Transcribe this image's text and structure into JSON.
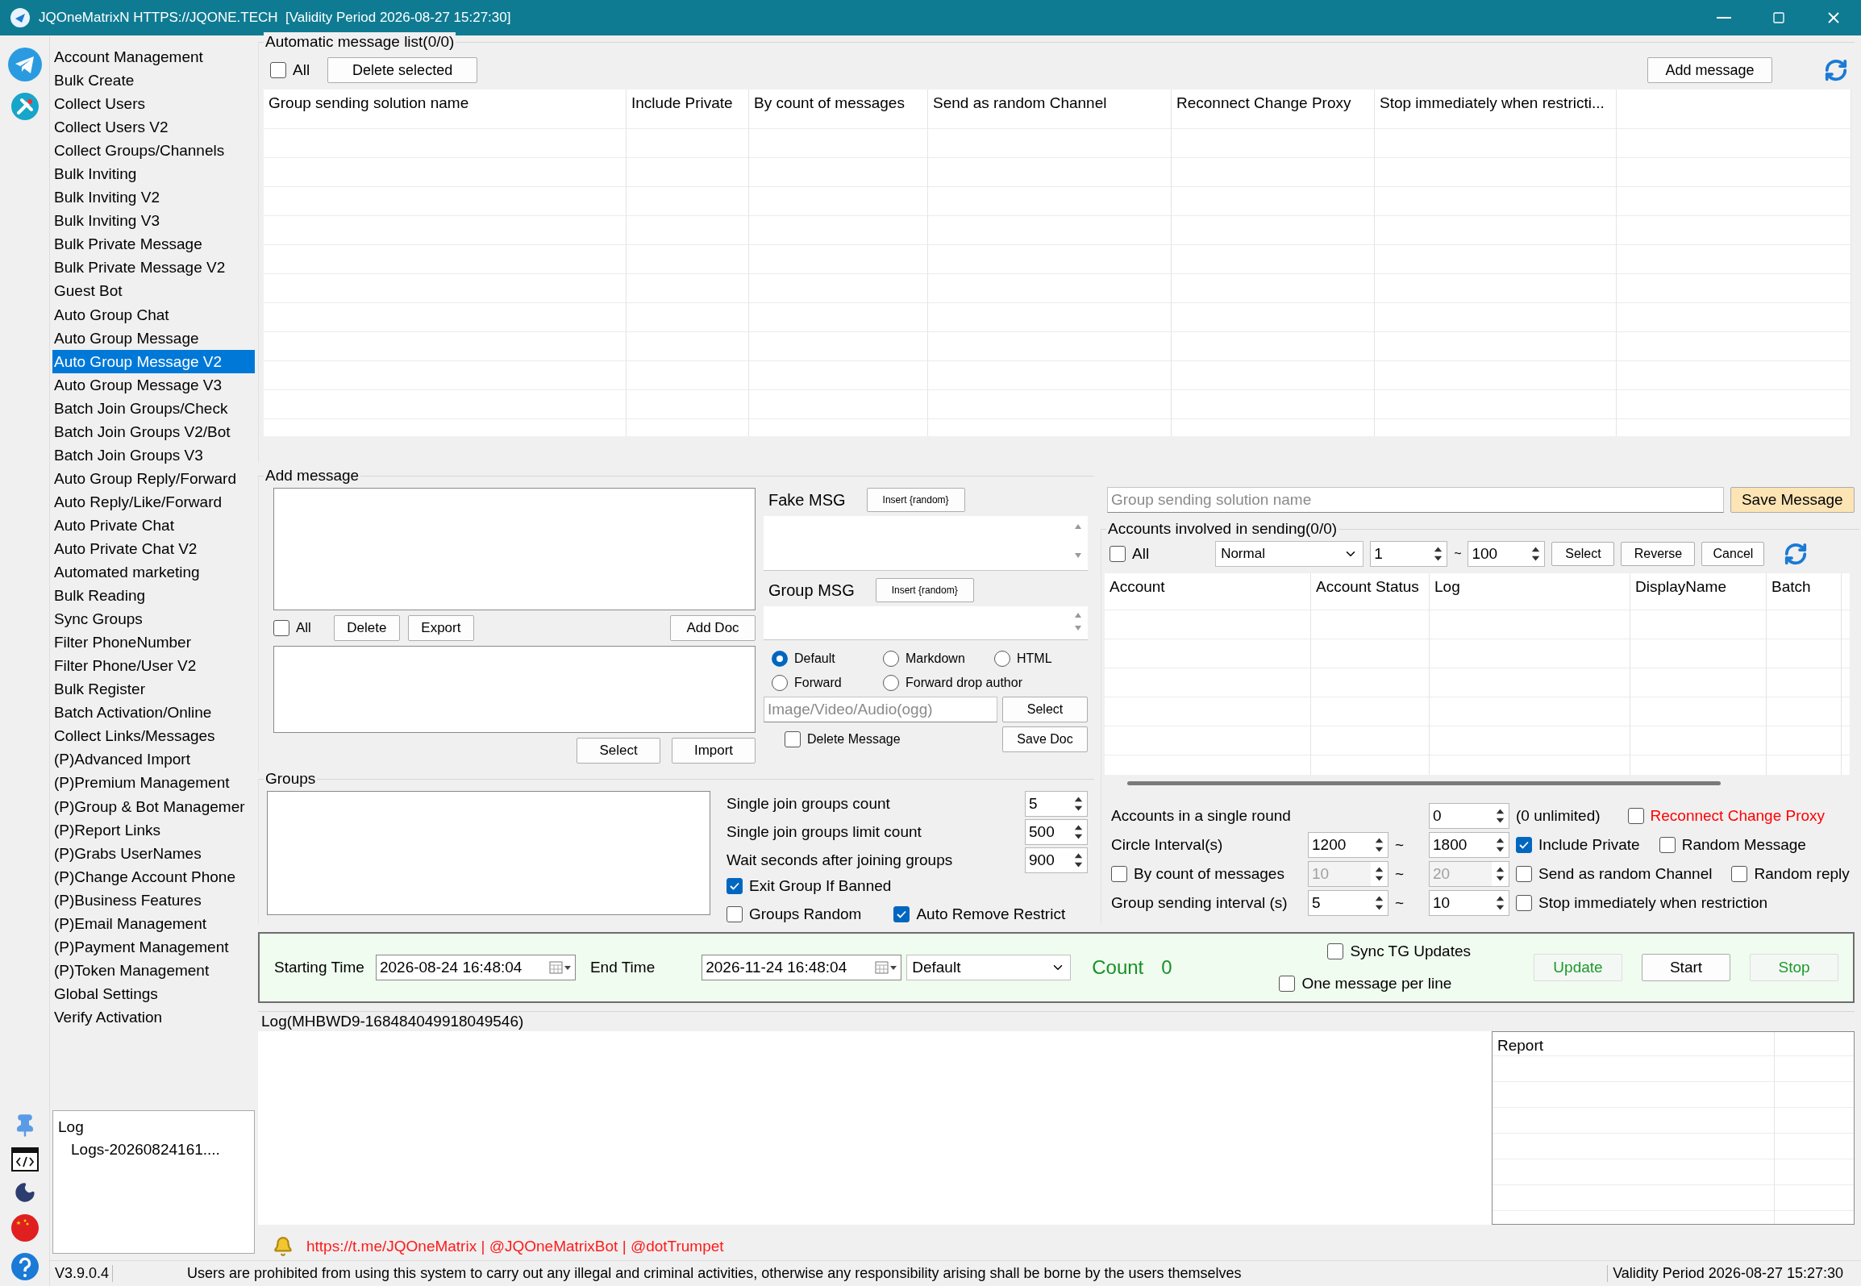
{
  "window": {
    "title": "JQOneMatrixN HTTPS://JQONE.TECH  [Validity Period 2026-08-27 15:27:30]"
  },
  "sidebar": {
    "items": [
      {
        "label": "Account Management",
        "selected": false
      },
      {
        "label": "Bulk Create",
        "selected": false
      },
      {
        "label": "Collect Users",
        "selected": false
      },
      {
        "label": "Collect Users V2",
        "selected": false
      },
      {
        "label": "Collect Groups/Channels",
        "selected": false
      },
      {
        "label": "Bulk Inviting",
        "selected": false
      },
      {
        "label": "Bulk Inviting V2",
        "selected": false
      },
      {
        "label": "Bulk Inviting V3",
        "selected": false
      },
      {
        "label": "Bulk Private Message",
        "selected": false
      },
      {
        "label": "Bulk Private Message V2",
        "selected": false
      },
      {
        "label": "Guest Bot",
        "selected": false
      },
      {
        "label": "Auto Group Chat",
        "selected": false
      },
      {
        "label": "Auto Group Message",
        "selected": false
      },
      {
        "label": "Auto Group Message V2",
        "selected": true
      },
      {
        "label": "Auto Group Message V3",
        "selected": false
      },
      {
        "label": "Batch Join Groups/Check",
        "selected": false
      },
      {
        "label": "Batch Join Groups V2/Bot",
        "selected": false
      },
      {
        "label": "Batch Join Groups V3",
        "selected": false
      },
      {
        "label": "Auto Group Reply/Forward",
        "selected": false
      },
      {
        "label": "Auto Reply/Like/Forward",
        "selected": false
      },
      {
        "label": "Auto Private Chat",
        "selected": false
      },
      {
        "label": "Auto Private Chat V2",
        "selected": false
      },
      {
        "label": "Automated marketing",
        "selected": false
      },
      {
        "label": "Bulk Reading",
        "selected": false
      },
      {
        "label": "Sync Groups",
        "selected": false
      },
      {
        "label": "Filter PhoneNumber",
        "selected": false
      },
      {
        "label": "Filter Phone/User V2",
        "selected": false
      },
      {
        "label": "Bulk Register",
        "selected": false
      },
      {
        "label": "Batch Activation/Online",
        "selected": false
      },
      {
        "label": "Collect Links/Messages",
        "selected": false
      },
      {
        "label": "(P)Advanced Import",
        "selected": false
      },
      {
        "label": "(P)Premium Management",
        "selected": false
      },
      {
        "label": "(P)Group & Bot Managemer",
        "selected": false
      },
      {
        "label": "(P)Report Links",
        "selected": false
      },
      {
        "label": "(P)Grabs UserNames",
        "selected": false
      },
      {
        "label": "(P)Change Account Phone",
        "selected": false
      },
      {
        "label": "(P)Business Features",
        "selected": false
      },
      {
        "label": "(P)Email Management",
        "selected": false
      },
      {
        "label": "(P)Payment Management",
        "selected": false
      },
      {
        "label": "(P)Token Management",
        "selected": false
      },
      {
        "label": "Global Settings",
        "selected": false
      },
      {
        "label": "Verify Activation",
        "selected": false
      }
    ],
    "log_panel": {
      "title": "Log",
      "entries": [
        "Logs-20260824161...."
      ]
    },
    "version": "V3.9.0.4"
  },
  "message_list": {
    "title": "Automatic message list(0/0)",
    "all": {
      "label": "All",
      "checked": false
    },
    "delete_button": "Delete selected",
    "add_button": "Add message",
    "columns": [
      "Group sending solution name",
      "Include Private",
      "By count of messages",
      "Send as random Channel",
      "Reconnect Change Proxy",
      "Stop immediately when restricti..."
    ]
  },
  "add_message": {
    "title": "Add message",
    "all": {
      "label": "All",
      "checked": false
    },
    "list_buttons": [
      "Delete",
      "Export"
    ],
    "add_doc_button": "Add Doc",
    "file_buttons": [
      "Select",
      "Import"
    ],
    "fake_msg": {
      "label": "Fake MSG",
      "insert_button": "Insert {random}"
    },
    "group_msg": {
      "label": "Group MSG",
      "insert_button": "Insert {random}"
    },
    "formats": [
      {
        "label": "Default",
        "selected": true
      },
      {
        "label": "Markdown",
        "selected": false
      },
      {
        "label": "HTML",
        "selected": false
      },
      {
        "label": "Forward",
        "selected": false
      },
      {
        "label": "Forward drop author",
        "selected": false
      }
    ],
    "media": {
      "placeholder": "Image/Video/Audio(ogg)",
      "select_button": "Select"
    },
    "delete_message": {
      "label": "Delete Message",
      "checked": false
    },
    "save_doc_button": "Save Doc"
  },
  "groups": {
    "title": "Groups",
    "counts": [
      {
        "label": "Single join groups count",
        "value": "5",
        "disabled": false
      },
      {
        "label": "Single join groups limit count",
        "value": "500",
        "disabled": false
      },
      {
        "label": "Wait seconds after joining groups",
        "value": "900",
        "disabled": false
      }
    ],
    "options": [
      {
        "label": "Exit Group If Banned",
        "checked": true
      },
      {
        "label": "Groups Random",
        "checked": false
      },
      {
        "label": "Auto Remove Restrict",
        "checked": true
      }
    ]
  },
  "solution": {
    "placeholder": "Group sending solution name",
    "save_button": "Save Message"
  },
  "accounts": {
    "title": "Accounts involved in sending(0/0)",
    "all": {
      "label": "All",
      "checked": false
    },
    "filter": "Normal",
    "from": {
      "value": "1",
      "disabled": false
    },
    "separator": "~",
    "to": {
      "value": "100",
      "disabled": false
    },
    "buttons": [
      "Select",
      "Reverse",
      "Cancel"
    ],
    "columns": [
      "Account",
      "Account Status",
      "Log",
      "DisplayName",
      "Batch"
    ]
  },
  "settings": {
    "per_round": {
      "label": "Accounts in a single round",
      "spinner": {
        "value": "0",
        "disabled": false
      },
      "note": "(0 unlimited)"
    },
    "circle": {
      "label": "Circle Interval(s)",
      "from": {
        "value": "1200",
        "disabled": false
      },
      "separator": "~",
      "to": {
        "value": "1800",
        "disabled": false
      }
    },
    "by_count": {
      "label": "By count of messages",
      "checked": false,
      "from": {
        "value": "10",
        "disabled": true
      },
      "separator": "~",
      "to": {
        "value": "20",
        "disabled": true
      }
    },
    "interval": {
      "label": "Group sending interval (s)",
      "from": {
        "value": "5",
        "disabled": false
      },
      "separator": "~",
      "to": {
        "value": "10",
        "disabled": false
      }
    },
    "option_rows": [
      {
        "options": [
          {
            "label": "Reconnect Change Proxy",
            "checked": false,
            "color": "#ff0000"
          }
        ]
      },
      {
        "options": [
          {
            "label": "Include Private",
            "checked": true,
            "color": "#000000"
          },
          {
            "label": "Random Message",
            "checked": false,
            "color": "#000000"
          }
        ]
      },
      {
        "options": [
          {
            "label": "Send as random Channel",
            "checked": false,
            "color": "#000000"
          },
          {
            "label": "Random reply",
            "checked": false,
            "color": "#000000"
          }
        ]
      },
      {
        "options": [
          {
            "label": "Stop immediately when restriction",
            "checked": false,
            "color": "#000000"
          }
        ]
      }
    ]
  },
  "schedule": {
    "start_label": "Starting Time",
    "start": "2026-08-24 16:48:04",
    "end_label": "End Time",
    "end": "2026-11-24 16:48:04",
    "mode": "Default",
    "count_label": "Count",
    "count": "0",
    "options": [
      {
        "label": "Sync TG Updates",
        "checked": false
      },
      {
        "label": "One message per line",
        "checked": false
      }
    ],
    "buttons": [
      {
        "label": "Update",
        "color": "#1a9a2a"
      },
      {
        "label": "Start",
        "color": "#000000"
      },
      {
        "label": "Stop",
        "color": "#1a9a2a"
      }
    ]
  },
  "log": {
    "title": "Log(MHBWD9-168484049918049546)",
    "report_column": "Report"
  },
  "footer": {
    "links": "https://t.me/JQOneMatrix | @JQOneMatrixBot | @dotTrumpet",
    "notice": "Users are prohibited from using this system to carry out any illegal and criminal activities, otherwise any responsibility arising shall be borne by the users themselves",
    "validity": "Validity Period 2026-08-27 15:27:30"
  }
}
